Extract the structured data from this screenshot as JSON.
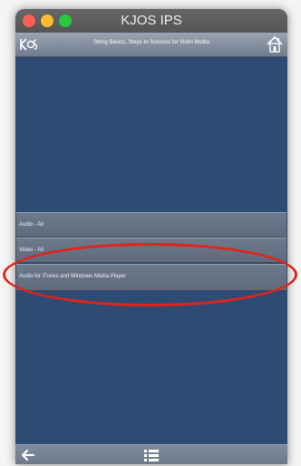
{
  "window": {
    "title": "KJOS IPS"
  },
  "header": {
    "logo_text": "KJOS",
    "title": "String Basics, Steps to Success for Violin Media"
  },
  "list": {
    "items": [
      {
        "label": "Audio - All"
      },
      {
        "label": "Video - All"
      },
      {
        "label": "Audio for iTunes and Windows Media Player"
      }
    ]
  },
  "icons": {
    "home": "home-icon",
    "back": "back-arrow-icon",
    "menu": "list-menu-icon"
  },
  "colors": {
    "background": "#2e4b74",
    "highlight": "#e2231a"
  }
}
